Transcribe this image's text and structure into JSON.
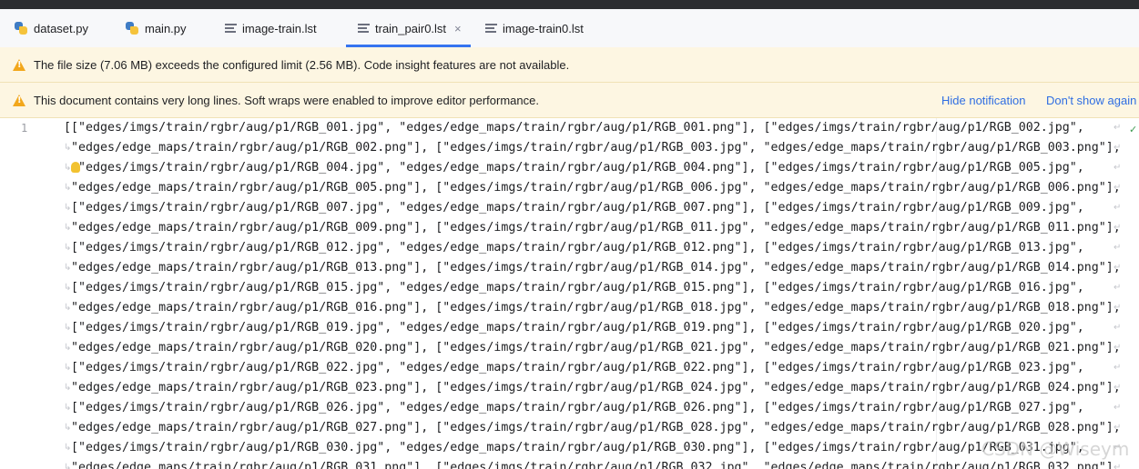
{
  "tabs": [
    {
      "label": "dataset.py",
      "icon": "python-file-icon",
      "active": false
    },
    {
      "label": "main.py",
      "icon": "python-file-icon",
      "active": false
    },
    {
      "label": "image-train.lst",
      "icon": "text-file-icon",
      "active": false
    },
    {
      "label": "train_pair0.lst",
      "icon": "text-file-icon",
      "active": true,
      "close": "×"
    },
    {
      "label": "image-train0.lst",
      "icon": "text-file-icon",
      "active": false
    }
  ],
  "banners": {
    "size_warning": "The file size (7.06 MB) exceeds the configured limit (2.56 MB). Code insight features are not available.",
    "long_lines": "This document contains very long lines. Soft wraps were enabled to improve editor performance.",
    "hide_notification": "Hide notification",
    "dont_show_again": "Don't show again"
  },
  "editor": {
    "line_number": "1",
    "lines": [
      "[[\"edges/imgs/train/rgbr/aug/p1/RGB_001.jpg\", \"edges/edge_maps/train/rgbr/aug/p1/RGB_001.png\"], [\"edges/imgs/train/rgbr/aug/p1/RGB_002.jpg\",",
      " \"edges/edge_maps/train/rgbr/aug/p1/RGB_002.png\"], [\"edges/imgs/train/rgbr/aug/p1/RGB_003.jpg\", \"edges/edge_maps/train/rgbr/aug/p1/RGB_003.png\"],",
      "  \"edges/imgs/train/rgbr/aug/p1/RGB_004.jpg\", \"edges/edge_maps/train/rgbr/aug/p1/RGB_004.png\"], [\"edges/imgs/train/rgbr/aug/p1/RGB_005.jpg\",",
      " \"edges/edge_maps/train/rgbr/aug/p1/RGB_005.png\"], [\"edges/imgs/train/rgbr/aug/p1/RGB_006.jpg\", \"edges/edge_maps/train/rgbr/aug/p1/RGB_006.png\"],",
      " [\"edges/imgs/train/rgbr/aug/p1/RGB_007.jpg\", \"edges/edge_maps/train/rgbr/aug/p1/RGB_007.png\"], [\"edges/imgs/train/rgbr/aug/p1/RGB_009.jpg\",",
      " \"edges/edge_maps/train/rgbr/aug/p1/RGB_009.png\"], [\"edges/imgs/train/rgbr/aug/p1/RGB_011.jpg\", \"edges/edge_maps/train/rgbr/aug/p1/RGB_011.png\"],",
      " [\"edges/imgs/train/rgbr/aug/p1/RGB_012.jpg\", \"edges/edge_maps/train/rgbr/aug/p1/RGB_012.png\"], [\"edges/imgs/train/rgbr/aug/p1/RGB_013.jpg\",",
      " \"edges/edge_maps/train/rgbr/aug/p1/RGB_013.png\"], [\"edges/imgs/train/rgbr/aug/p1/RGB_014.jpg\", \"edges/edge_maps/train/rgbr/aug/p1/RGB_014.png\"],",
      " [\"edges/imgs/train/rgbr/aug/p1/RGB_015.jpg\", \"edges/edge_maps/train/rgbr/aug/p1/RGB_015.png\"], [\"edges/imgs/train/rgbr/aug/p1/RGB_016.jpg\",",
      " \"edges/edge_maps/train/rgbr/aug/p1/RGB_016.png\"], [\"edges/imgs/train/rgbr/aug/p1/RGB_018.jpg\", \"edges/edge_maps/train/rgbr/aug/p1/RGB_018.png\"],",
      " [\"edges/imgs/train/rgbr/aug/p1/RGB_019.jpg\", \"edges/edge_maps/train/rgbr/aug/p1/RGB_019.png\"], [\"edges/imgs/train/rgbr/aug/p1/RGB_020.jpg\",",
      " \"edges/edge_maps/train/rgbr/aug/p1/RGB_020.png\"], [\"edges/imgs/train/rgbr/aug/p1/RGB_021.jpg\", \"edges/edge_maps/train/rgbr/aug/p1/RGB_021.png\"],",
      " [\"edges/imgs/train/rgbr/aug/p1/RGB_022.jpg\", \"edges/edge_maps/train/rgbr/aug/p1/RGB_022.png\"], [\"edges/imgs/train/rgbr/aug/p1/RGB_023.jpg\",",
      " \"edges/edge_maps/train/rgbr/aug/p1/RGB_023.png\"], [\"edges/imgs/train/rgbr/aug/p1/RGB_024.jpg\", \"edges/edge_maps/train/rgbr/aug/p1/RGB_024.png\"],",
      " [\"edges/imgs/train/rgbr/aug/p1/RGB_026.jpg\", \"edges/edge_maps/train/rgbr/aug/p1/RGB_026.png\"], [\"edges/imgs/train/rgbr/aug/p1/RGB_027.jpg\",",
      " \"edges/edge_maps/train/rgbr/aug/p1/RGB_027.png\"], [\"edges/imgs/train/rgbr/aug/p1/RGB_028.jpg\", \"edges/edge_maps/train/rgbr/aug/p1/RGB_028.png\"],",
      " [\"edges/imgs/train/rgbr/aug/p1/RGB_030.jpg\", \"edges/edge_maps/train/rgbr/aug/p1/RGB_030.png\"], [\"edges/imgs/train/rgbr/aug/p1/RGB_031.jpg\",",
      " \"edges/edge_maps/train/rgbr/aug/p1/RGB_031.png\"], [\"edges/imgs/train/rgbr/aug/p1/RGB_032.jpg\", \"edges/edge_maps/train/rgbr/aug/p1/RGB_032.png\"],"
    ]
  },
  "watermark": "CSDN @Wiseym",
  "colors": {
    "accent": "#3574f0",
    "warning": "#f2a71b",
    "banner_bg": "#fdf6e2",
    "link": "#2f6ee2"
  }
}
